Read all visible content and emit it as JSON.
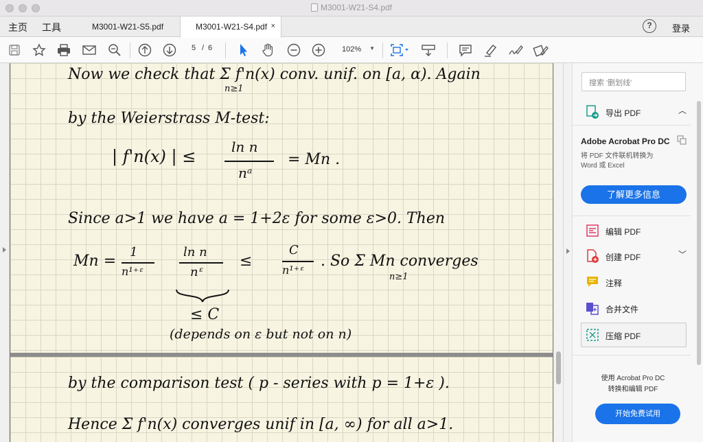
{
  "window": {
    "title": "M3001-W21-S4.pdf"
  },
  "nav": {
    "home": "主页",
    "tools": "工具",
    "login": "登录",
    "help": "?"
  },
  "tabs": [
    {
      "label": "M3001-W21-S5.pdf"
    },
    {
      "label": "M3001-W21-S4.pdf",
      "close": "×"
    }
  ],
  "toolbar": {
    "page_current": "5",
    "page_sep": "/",
    "page_total": "6",
    "zoom": "102%",
    "icons": [
      "save-icon",
      "bookmark-star-icon",
      "print-icon",
      "email-icon",
      "zoom-search-icon",
      "page-up-icon",
      "page-down-icon",
      "select-cursor-icon",
      "hand-icon",
      "zoom-out-icon",
      "zoom-in-icon",
      "fit-page-icon",
      "scroll-mode-icon",
      "comment-icon",
      "highlight-icon",
      "sign-icon",
      "fill-sign-icon"
    ]
  },
  "document": {
    "page1_lines": [
      "Now we check that  Σ  f'n(x)  conv. unif. on [a, α). Again",
      "n≥1",
      "by the Weierstrass M-test:",
      "| f'n(x) |  ≤",
      "ln n",
      "nᵃ",
      "= Mn .",
      "Since   a>1   we  have    a = 1+2ε   for some  ε>0.  Then",
      "Mn =",
      "1",
      "n¹⁺ᵋ",
      "ln n",
      "nᵋ",
      "≤",
      "C",
      "n¹⁺ᵋ",
      ".   So   Σ  Mn  converges",
      "n≥1",
      "≤ C",
      "(depends on ε but not on n)"
    ],
    "page2_lines": [
      "by the comparison test  ( p - series with  p = 1+ε ).",
      "Hence   Σ  f'n(x)  converges unif  in  [a, ∞)  for all a>1."
    ]
  },
  "panel": {
    "search_placeholder": "搜索 '删划线'",
    "export_pdf": "导出 PDF",
    "promo_title": "Adobe Acrobat Pro DC",
    "promo_desc_line1": "将 PDF 文件联机转换为",
    "promo_desc_line2": "Word 或 Excel",
    "learn_more": "了解更多信息",
    "edit_pdf": "编辑 PDF",
    "create_pdf": "创建 PDF",
    "comment": "注释",
    "combine": "合并文件",
    "compress_pdf": "压缩 PDF",
    "bottom_line1": "使用 Acrobat Pro DC",
    "bottom_line2": "转换和编辑 PDF",
    "trial_button": "开始免费试用"
  },
  "colors": {
    "accent": "#1a73e8",
    "paper": "#f7f4e2",
    "grid": "#d9d6c3"
  }
}
